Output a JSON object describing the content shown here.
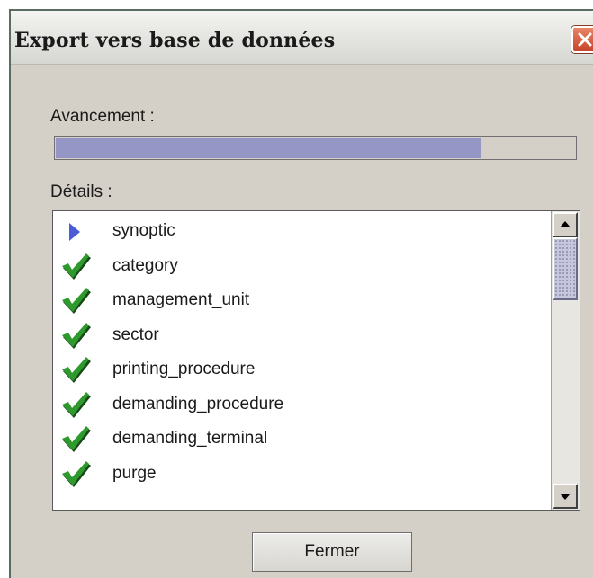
{
  "window": {
    "title": "Export vers base de données",
    "close_icon": "close-x-icon"
  },
  "progress": {
    "label": "Avancement :",
    "value_fraction": 0.82,
    "fill_color": "#9595c6"
  },
  "details": {
    "label": "Détails :",
    "items": [
      {
        "status_icon": "arrow-right-icon",
        "label": "synoptic"
      },
      {
        "status_icon": "checkmark-icon",
        "label": "category"
      },
      {
        "status_icon": "checkmark-icon",
        "label": "management_unit"
      },
      {
        "status_icon": "checkmark-icon",
        "label": "sector"
      },
      {
        "status_icon": "checkmark-icon",
        "label": "printing_procedure"
      },
      {
        "status_icon": "checkmark-icon",
        "label": "demanding_procedure"
      },
      {
        "status_icon": "checkmark-icon",
        "label": "demanding_terminal"
      },
      {
        "status_icon": "checkmark-icon",
        "label": "purge"
      }
    ]
  },
  "buttons": {
    "close_label": "Fermer"
  },
  "colors": {
    "window_bg": "#d4d0c8",
    "check_green": "#2e9a2e",
    "arrow_blue": "#4a5cd8"
  }
}
